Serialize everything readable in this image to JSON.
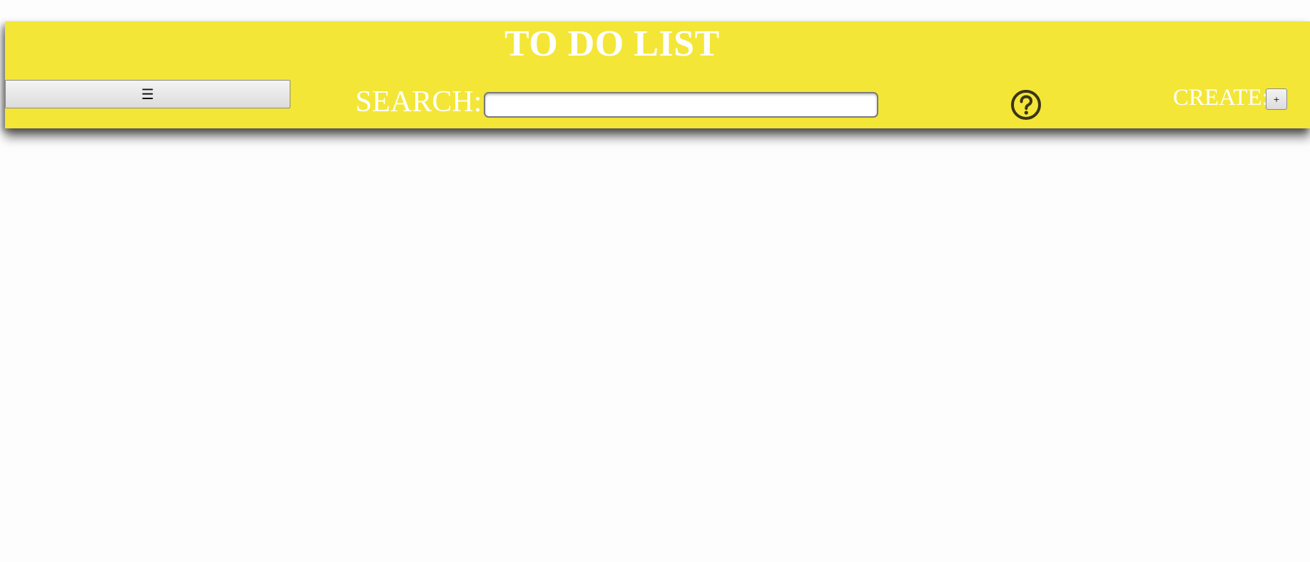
{
  "header": {
    "title": "TO DO LIST",
    "menu_button_label": "☰",
    "search": {
      "label": "SEARCH:",
      "value": "",
      "placeholder": ""
    },
    "help_icon": "question-circle-icon",
    "create": {
      "label": "CREATE:",
      "button_label": "+"
    }
  },
  "colors": {
    "header_background": "#f3e637",
    "header_text": "#ffffff",
    "icon_color": "#3b3416",
    "page_background": "#fdfdfd"
  }
}
